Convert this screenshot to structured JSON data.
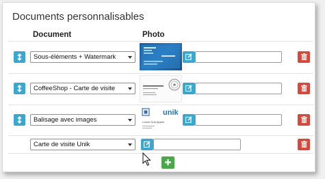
{
  "section": {
    "title": "Documents personnalisables"
  },
  "columns": {
    "document": "Document",
    "photo": "Photo"
  },
  "rows": [
    {
      "document": "Sous-éléments + Watermark",
      "photo_value": ""
    },
    {
      "document": "CoffeeShop - Carte de visite",
      "photo_value": ""
    },
    {
      "document": "Balisage avec images",
      "photo_value": ""
    },
    {
      "document": "Carte de visite Unik",
      "photo_value": ""
    }
  ],
  "thumbnails": {
    "brand_mark": "unik",
    "card_name": "Lorem Dolt Ayadic"
  },
  "colors": {
    "info": "#3aa7cf",
    "danger": "#d64a3e",
    "success": "#4ba84a"
  },
  "icons": {
    "move": "vertical-arrows-icon",
    "edit": "edit-icon",
    "delete": "trash-icon",
    "add": "plus-icon"
  }
}
